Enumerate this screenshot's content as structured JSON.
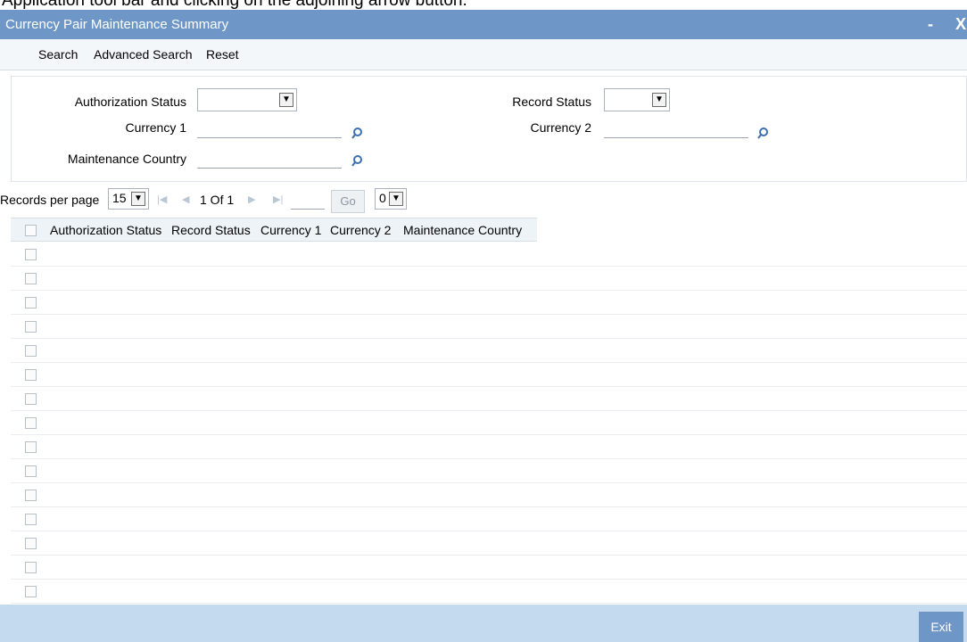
{
  "caption": "Application tool bar and clicking on the adjoining arrow button.",
  "window": {
    "title": "Currency Pair Maintenance Summary",
    "minimize": "-",
    "close": "X"
  },
  "menu": {
    "search": "Search",
    "advanced_search": "Advanced Search",
    "reset": "Reset"
  },
  "criteria": {
    "auth_status_label": "Authorization Status",
    "auth_status_value": "",
    "record_status_label": "Record Status",
    "record_status_value": "",
    "currency1_label": "Currency 1",
    "currency1_value": "",
    "currency2_label": "Currency 2",
    "currency2_value": "",
    "country_label": "Maintenance Country",
    "country_value": ""
  },
  "pager": {
    "records_label": "Records per page",
    "records_value": "15",
    "page_info": "1 Of 1",
    "go_label": "Go",
    "page_select_value": "0"
  },
  "grid": {
    "columns": [
      "Authorization Status",
      "Record Status",
      "Currency 1",
      "Currency 2",
      "Maintenance Country"
    ],
    "row_count": 15
  },
  "footer": {
    "exit_label": "Exit"
  },
  "colors": {
    "titlebar": "#6e97c8",
    "footer": "#c4dbef",
    "menubar": "#f4f7fa",
    "header": "#eef3f8"
  }
}
